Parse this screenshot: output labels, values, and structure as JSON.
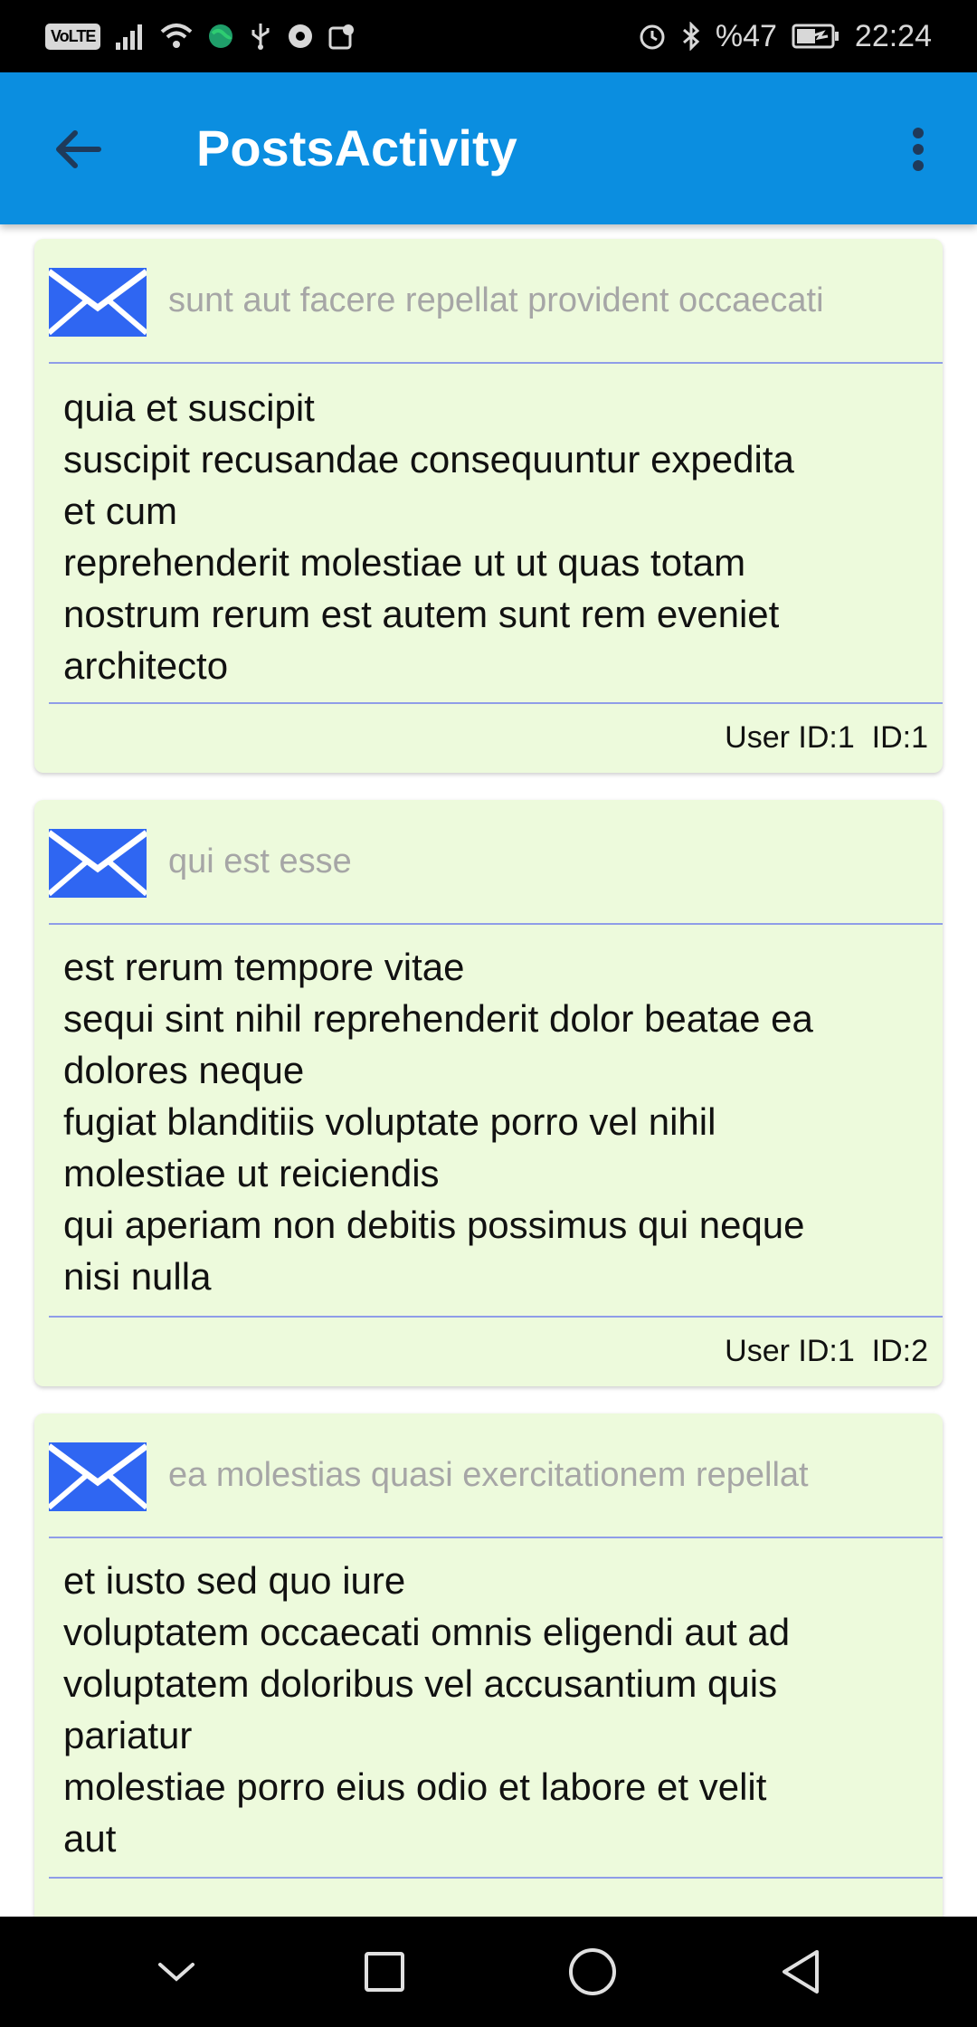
{
  "status_bar": {
    "left_icons": [
      "volte-icon",
      "signal-icon",
      "wifi-icon",
      "globe-icon",
      "usb-icon",
      "chrome-icon",
      "location-icon"
    ],
    "volte_label": "VoLTE",
    "battery_text": "%47",
    "time": "22:24"
  },
  "app_bar": {
    "title": "PostsActivity",
    "back_icon": "arrow-back-icon",
    "menu_icon": "more-vert-icon",
    "color": "#0b8ee0"
  },
  "posts": [
    {
      "title": "sunt aut facere repellat provident occaecati",
      "body": [
        "quia et suscipit",
        "suscipit recusandae consequuntur expedita",
        "et cum",
        "reprehenderit molestiae ut ut quas totam",
        "nostrum rerum est autem sunt rem eveniet",
        "architecto"
      ],
      "footer": "User ID:1  ID:1"
    },
    {
      "title": "qui est esse",
      "body": [
        "est rerum tempore vitae",
        "sequi sint nihil reprehenderit dolor beatae ea",
        "dolores neque",
        "fugiat blanditiis voluptate porro vel nihil",
        "molestiae ut reiciendis",
        "qui aperiam non debitis possimus qui neque",
        "nisi nulla"
      ],
      "footer": "User ID:1  ID:2"
    },
    {
      "title": "ea molestias quasi exercitationem repellat",
      "body": [
        "et iusto sed quo iure",
        "voluptatem occaecati omnis eligendi aut ad",
        "voluptatem doloribus vel accusantium quis",
        "pariatur",
        "molestiae porro eius odio et labore et velit",
        "aut"
      ],
      "footer": ""
    }
  ],
  "colors": {
    "card_bg": "#edfadc",
    "divider": "#8f9de8",
    "mail_icon": "#2f66f2",
    "title_text": "#a6a6a6"
  },
  "nav_bar": {
    "buttons": [
      "chevron-down-icon",
      "recents-square-icon",
      "home-circle-icon",
      "back-triangle-icon"
    ]
  }
}
